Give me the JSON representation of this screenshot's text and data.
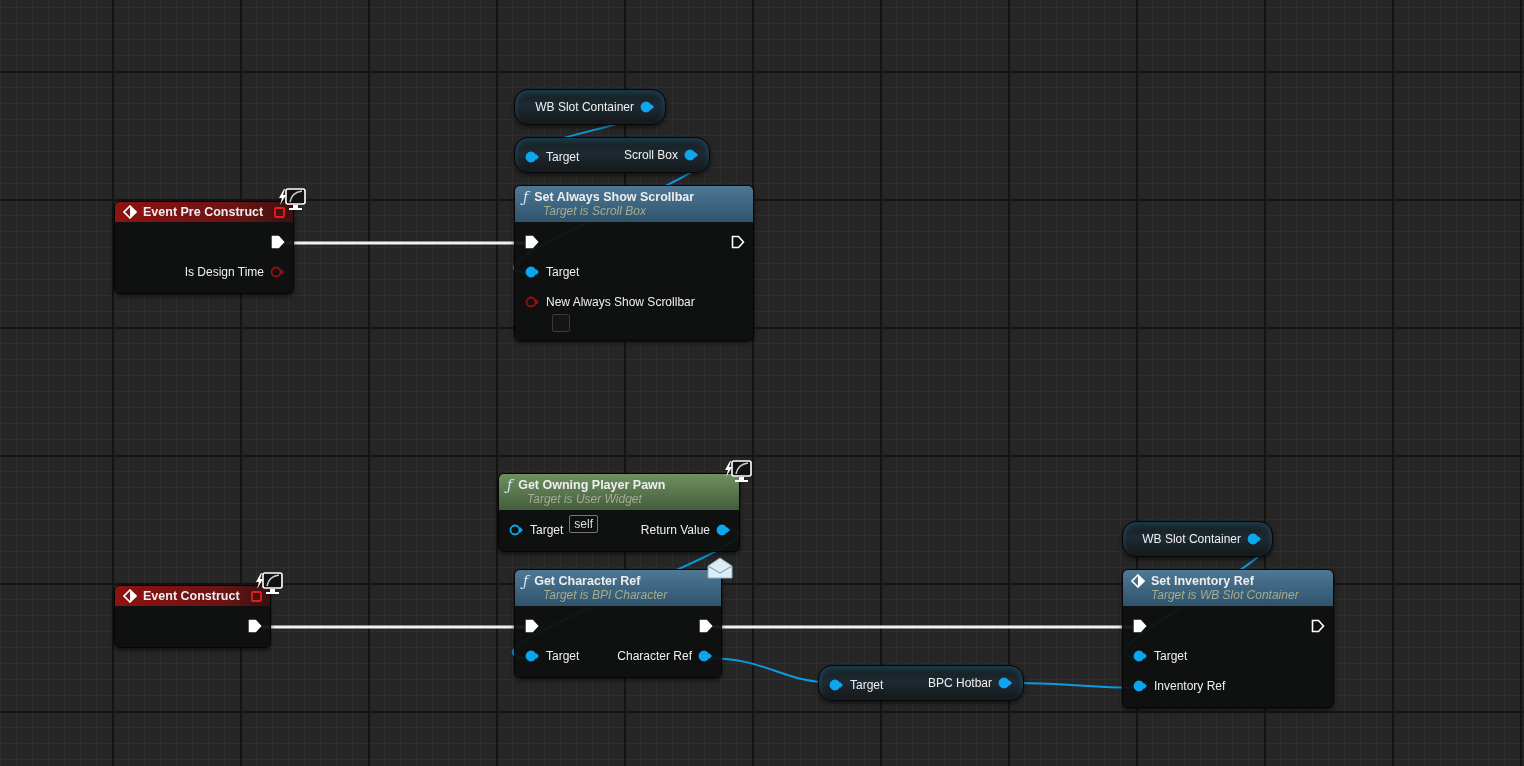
{
  "nodes": [
    {
      "kind": "event",
      "title": "Event Pre Construct",
      "client_only": true,
      "rows": [
        {
          "out": {
            "kind": "exec",
            "connected": true
          }
        },
        {
          "out": {
            "kind": "bool",
            "label": "Is Design Time",
            "connected": false
          }
        }
      ]
    },
    {
      "kind": "variable",
      "rows": [
        {
          "out": {
            "kind": "object",
            "label": "WB Slot Container",
            "connected": true
          }
        }
      ]
    },
    {
      "kind": "getter",
      "rows": [
        {
          "in": {
            "kind": "object",
            "label": "Target",
            "connected": true
          },
          "out": {
            "kind": "object",
            "label": "Scroll Box",
            "connected": true
          }
        }
      ]
    },
    {
      "kind": "function",
      "title": "Set Always Show Scrollbar",
      "subtitle": "Target is Scroll Box",
      "glyph": "ƒ",
      "rows": [
        {
          "in": {
            "kind": "exec",
            "connected": true
          },
          "out": {
            "kind": "exec",
            "connected": false
          }
        },
        {
          "in": {
            "kind": "object",
            "label": "Target",
            "connected": true
          }
        },
        {
          "in": {
            "kind": "bool",
            "label": "New Always Show Scrollbar",
            "connected": false,
            "checkbox": {
              "checked": false
            }
          }
        }
      ]
    },
    {
      "kind": "pure",
      "title": "Get Owning Player Pawn",
      "subtitle": "Target is User Widget",
      "glyph": "ƒ",
      "client_only": true,
      "rows": [
        {
          "in": {
            "kind": "object",
            "label": "Target",
            "connected": false,
            "default": "self"
          },
          "out": {
            "kind": "object",
            "label": "Return Value",
            "connected": true
          }
        }
      ]
    },
    {
      "kind": "event",
      "title": "Event Construct",
      "client_only": true,
      "rows": [
        {
          "out": {
            "kind": "exec",
            "connected": true
          }
        }
      ]
    },
    {
      "kind": "function",
      "title": "Get Character Ref",
      "subtitle": "Target is BPI Character",
      "glyph": "ƒ",
      "message": true,
      "rows": [
        {
          "in": {
            "kind": "exec",
            "connected": true
          },
          "out": {
            "kind": "exec",
            "connected": true
          }
        },
        {
          "in": {
            "kind": "object",
            "label": "Target",
            "connected": true
          },
          "out": {
            "kind": "object",
            "label": "Character Ref",
            "connected": true
          }
        }
      ]
    },
    {
      "kind": "variable",
      "rows": [
        {
          "out": {
            "kind": "object",
            "label": "WB Slot Container",
            "connected": true
          }
        }
      ]
    },
    {
      "kind": "getter",
      "rows": [
        {
          "in": {
            "kind": "object",
            "label": "Target",
            "connected": true
          },
          "out": {
            "kind": "object",
            "label": "BPC Hotbar",
            "connected": true
          }
        }
      ]
    },
    {
      "kind": "function",
      "title": "Set Inventory Ref",
      "subtitle": "Target is WB Slot Container",
      "rows": [
        {
          "in": {
            "kind": "exec",
            "connected": true
          },
          "out": {
            "kind": "exec",
            "connected": false
          }
        },
        {
          "in": {
            "kind": "object",
            "label": "Target",
            "connected": true
          }
        },
        {
          "in": {
            "kind": "object",
            "label": "Inventory Ref",
            "connected": true
          }
        }
      ]
    }
  ]
}
